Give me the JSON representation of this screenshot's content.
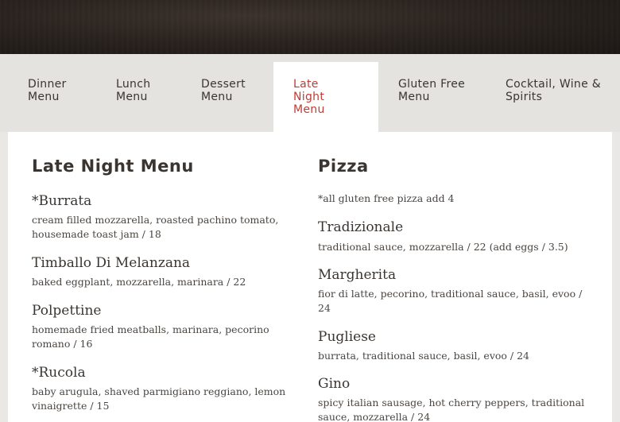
{
  "tabs": [
    {
      "label": "Dinner Menu",
      "active": false
    },
    {
      "label": "Lunch Menu",
      "active": false
    },
    {
      "label": "Dessert Menu",
      "active": false
    },
    {
      "label": "Late Night Menu",
      "active": true
    },
    {
      "label": "Gluten Free Menu",
      "active": false
    },
    {
      "label": "Cocktail, Wine & Spirits",
      "active": false
    }
  ],
  "left": {
    "title": "Late Night Menu",
    "items": [
      {
        "name": "*Burrata",
        "desc": "cream filled mozzarella, roasted pachino tomato, housemade toast jam / 18"
      },
      {
        "name": "Timballo Di Melanzana",
        "desc": "baked eggplant, mozzarella, marinara / 22"
      },
      {
        "name": "Polpettine",
        "desc": "homemade fried meatballs, marinara, pecorino romano / 16"
      },
      {
        "name": "*Rucola",
        "desc": "baby arugula, shaved parmigiano reggiano, lemon vinaigrette / 15"
      }
    ]
  },
  "right": {
    "title": "Pizza",
    "note": "*all gluten free pizza add 4",
    "items": [
      {
        "name": "Tradizionale",
        "desc": "traditional sauce, mozzarella / 22 (add eggs / 3.5)"
      },
      {
        "name": "Margherita",
        "desc": "fior di latte, pecorino, traditional sauce, basil, evoo / 24"
      },
      {
        "name": "Pugliese",
        "desc": "burrata, traditional sauce, basil, evoo / 24"
      },
      {
        "name": "Gino",
        "desc": "spicy italian sausage, hot cherry peppers, traditional sauce, mozzarella / 24"
      }
    ]
  },
  "colors": {
    "accent": "#c33a34",
    "text": "#3a3531",
    "background": "#e9e8e5"
  }
}
